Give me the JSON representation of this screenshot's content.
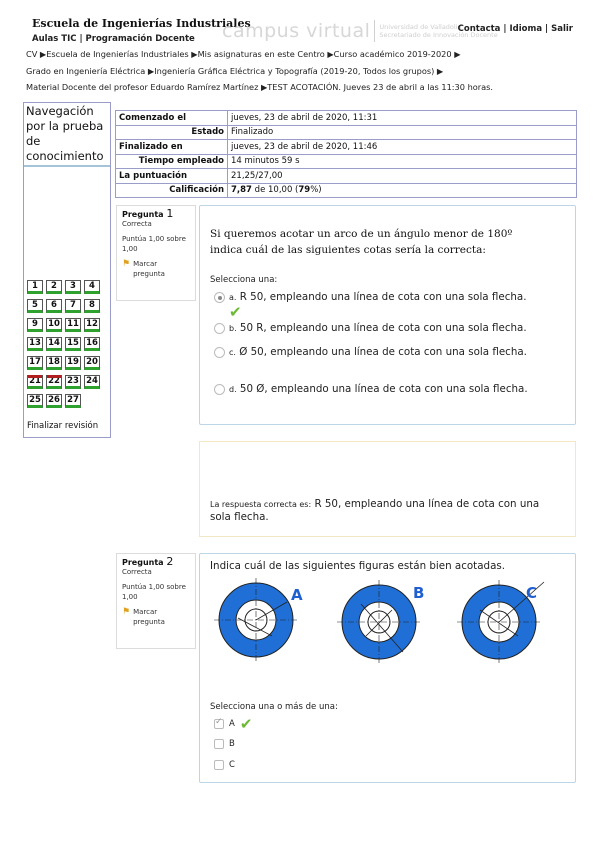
{
  "header": {
    "school": "Escuela de Ingenierías Industriales",
    "subnav": [
      "Aulas TIC",
      "Programación Docente"
    ],
    "logo_main": "campus virtual",
    "logo_sub": [
      "Universidad de Valladolid",
      "Secretariado de Innovación Docente"
    ],
    "links": [
      "Contacta",
      "Idioma",
      "Salir"
    ]
  },
  "breadcrumb": {
    "line1": [
      "CV",
      "Escuela de Ingenierías Industriales",
      "Mis asignaturas en este Centro",
      "Curso académico 2019-2020"
    ],
    "line2": [
      "Grado en Ingeniería Eléctrica",
      "Ingeniería Gráfica Eléctrica y Topografía (2019-20, Todos los grupos)"
    ],
    "line3": [
      "Material Docente del profesor Eduardo Ramírez Martínez",
      "TEST ACOTACIÓN. Jueves 23 de abril a las 11:30 horas."
    ]
  },
  "nav": {
    "title": "Navegación por la prueba de conocimiento",
    "questions": [
      "1",
      "2",
      "3",
      "4",
      "5",
      "6",
      "7",
      "8",
      "9",
      "10",
      "11",
      "12",
      "13",
      "14",
      "15",
      "16",
      "17",
      "18",
      "19",
      "20",
      "21",
      "22",
      "23",
      "24",
      "25",
      "26",
      "27"
    ],
    "incorrect": [
      "21",
      "22"
    ],
    "finish": "Finalizar revisión"
  },
  "summary": [
    {
      "k": "Comenzado el",
      "v": "jueves, 23 de abril de 2020, 11:31",
      "align": "left"
    },
    {
      "k": "Estado",
      "v": "Finalizado",
      "align": "right"
    },
    {
      "k": "Finalizado en",
      "v": "jueves, 23 de abril de 2020, 11:46",
      "align": "left"
    },
    {
      "k": "Tiempo empleado",
      "v": "14 minutos 59 s",
      "align": "right"
    },
    {
      "k": "La puntuación",
      "v": "21,25/27,00",
      "align": "left"
    },
    {
      "k": "Calificación",
      "v_bold": "7,87",
      "v_mid": " de 10,00 (",
      "v_pct": "79",
      "v_end": "%)",
      "align": "right"
    }
  ],
  "q1": {
    "label": "Pregunta",
    "number": "1",
    "state": "Correcta",
    "score": "Puntúa 1,00 sobre 1,00",
    "flag": "Marcar pregunta",
    "text_line1": "Si queremos acotar un arco de un ángulo menor de 180º",
    "text_line2": "indica cuál de las siguientes cotas sería la correcta:",
    "prompt": "Selecciona una:",
    "options": [
      {
        "letter": "a.",
        "text": "R 50, empleando una línea de cota con una sola flecha.",
        "selected": true
      },
      {
        "letter": "b.",
        "text": "50 R, empleando una línea de cota con una sola flecha.",
        "selected": false
      },
      {
        "letter": "c.",
        "text": "Ø 50, empleando una línea de cota con una sola flecha.",
        "selected": false
      },
      {
        "letter": "d.",
        "text": "50 Ø,  empleando una línea de cota con una sola flecha.",
        "selected": false
      }
    ],
    "feedback_label": "La respuesta correcta es:",
    "feedback_text": "R 50, empleando una línea de cota con una sola flecha."
  },
  "q2": {
    "label": "Pregunta",
    "number": "2",
    "state": "Correcta",
    "score": "Puntúa 1,00 sobre 1,00",
    "flag": "Marcar pregunta",
    "text": "Indica cuál de las siguientes figuras están bien acotadas.",
    "figure_letters": [
      "A",
      "B",
      "C"
    ],
    "prompt": "Selecciona una o más de una:",
    "options": [
      {
        "letter": "A",
        "checked": true
      },
      {
        "letter": "B",
        "checked": false
      },
      {
        "letter": "C",
        "checked": false
      }
    ]
  },
  "colors": {
    "ring_blue": "#1f6fd6",
    "correct_green": "#2ea12e",
    "incorrect_red": "#b02020",
    "border_blue": "#9a9cc9"
  }
}
